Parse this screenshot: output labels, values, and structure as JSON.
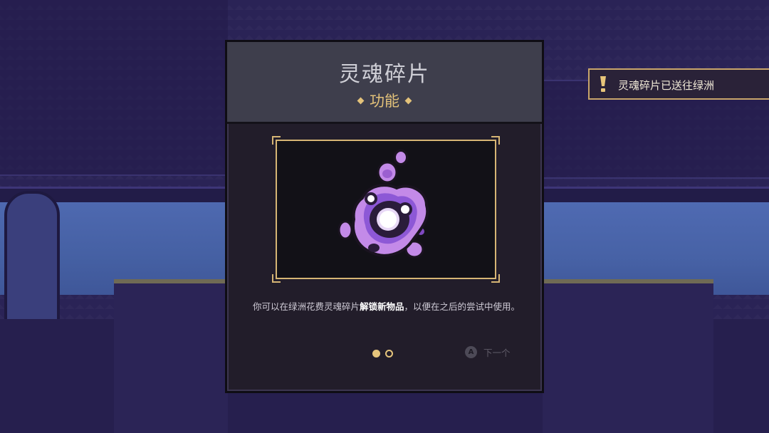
{
  "dialog": {
    "title": "灵魂碎片",
    "subtitle": "功能",
    "description_prefix": "你可以在绿洲花费灵魂碎片",
    "description_highlight": "解锁新物品",
    "description_suffix": "，以便在之后的尝试中使用。",
    "pagination": {
      "current_page": 1,
      "total_pages": 2
    },
    "next": {
      "button_glyph": "A",
      "label": "下一个"
    }
  },
  "notification": {
    "icon": "exclamation-icon",
    "text": "灵魂碎片已送往绿洲"
  },
  "colors": {
    "accent_gold": "#e3c27a",
    "soul_purple": "#b57ee6",
    "panel_header": "#3e3e4c",
    "panel_body": "#221d2a"
  }
}
